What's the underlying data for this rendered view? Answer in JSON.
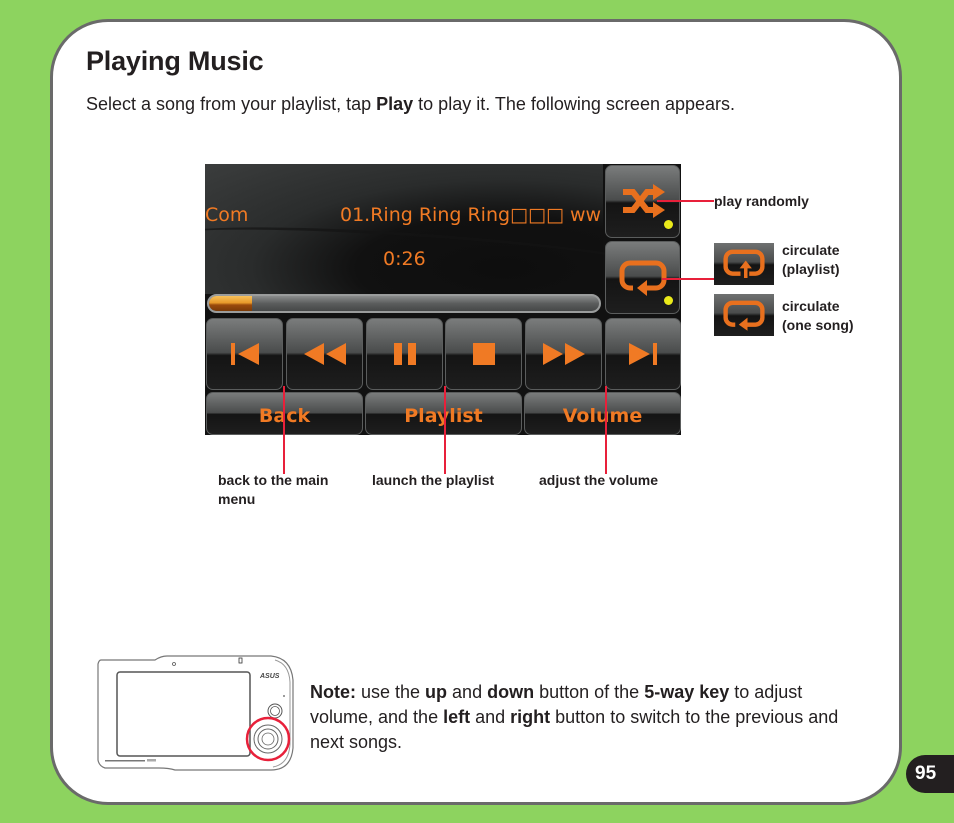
{
  "page": {
    "title": "Playing Music",
    "intro": {
      "before": "Select a song from your playlist, tap ",
      "bold": "Play",
      "after": " to play it. The following screen appears."
    },
    "page_number": "95"
  },
  "player": {
    "scroll_text_left": "Com",
    "song_title": "01.Ring Ring Ring□□□ ww",
    "elapsed_time": "0:26",
    "progress_percent": 11,
    "shuffle_button": {
      "icon": "shuffle-icon",
      "indicator_on": true
    },
    "repeat_button": {
      "icon": "repeat-icon",
      "indicator_on": true
    },
    "controls": [
      {
        "name": "previous-track-button",
        "icon": "skip-previous-icon"
      },
      {
        "name": "rewind-button",
        "icon": "rewind-icon"
      },
      {
        "name": "pause-button",
        "icon": "pause-icon"
      },
      {
        "name": "stop-button",
        "icon": "stop-icon"
      },
      {
        "name": "fast-forward-button",
        "icon": "fast-forward-icon"
      },
      {
        "name": "next-track-button",
        "icon": "skip-next-icon"
      }
    ],
    "bottom_buttons": {
      "back": "Back",
      "playlist": "Playlist",
      "volume": "Volume"
    },
    "colors": {
      "accent": "#f07a24",
      "indicator": "#eaea1a",
      "callout_line": "#e8203a"
    }
  },
  "annotations": {
    "play_randomly": "play randomly",
    "circulate_playlist_line1": "circulate",
    "circulate_playlist_line2": "(playlist)",
    "circulate_one_line1": "circulate",
    "circulate_one_line2": "(one song)",
    "back_line1": "back to the main",
    "back_line2": "menu",
    "playlist": "launch the playlist",
    "volume": "adjust the volume"
  },
  "note": {
    "label": "Note:",
    "t1": " use the ",
    "b1": "up",
    "t2": " and ",
    "b2": "down",
    "t3": " button of the ",
    "b3": "5-way key",
    "t4": " to adjust volume, and the ",
    "b4": "left",
    "t5": " and ",
    "b5": "right",
    "t6": " button to switch to the previous and next songs."
  },
  "device": {
    "brand": "ASUS"
  }
}
